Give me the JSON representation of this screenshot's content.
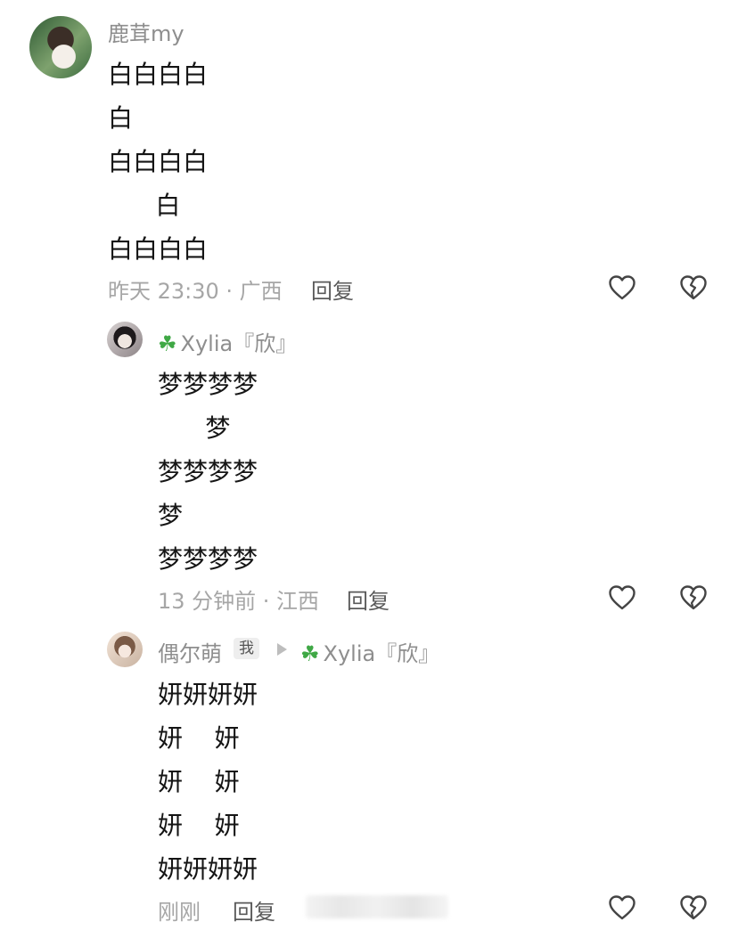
{
  "comments": [
    {
      "author": "鹿茸my",
      "lines": [
        "白白白白",
        "白",
        "白白白白",
        "      白",
        "白白白白"
      ],
      "meta": "昨天 23:30 · 广西",
      "reply_label": "回复"
    },
    {
      "author": "Xylia『欣』",
      "author_prefix_icon": "clover-icon",
      "lines": [
        "梦梦梦梦",
        "      梦",
        "梦梦梦梦",
        "梦",
        "梦梦梦梦"
      ],
      "meta": "13 分钟前 · 江西",
      "reply_label": "回复"
    },
    {
      "author": "偶尔萌",
      "badge": "我",
      "reply_to": "Xylia『欣』",
      "lines": [
        "妍妍妍妍",
        "妍    妍",
        "妍    妍",
        "妍    妍",
        "妍妍妍妍"
      ],
      "meta": "刚刚",
      "reply_label": "回复"
    }
  ],
  "colors": {
    "clover": "#3fa845",
    "meta": "#a6a6a6",
    "text": "#151515"
  }
}
